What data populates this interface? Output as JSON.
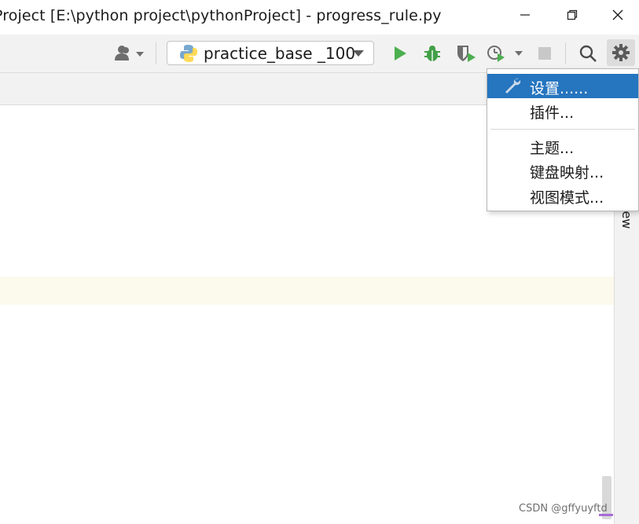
{
  "window": {
    "title": "Project [E:\\python project\\pythonProject] - progress_rule.py"
  },
  "toolbar": {
    "run_config_label": "practice_base _100",
    "icons": [
      "user-icon",
      "python-icon",
      "run-icon",
      "debug-icon",
      "coverage-icon",
      "profile-icon",
      "stop-icon",
      "search-icon",
      "gear-icon"
    ]
  },
  "settings_menu": {
    "items": [
      {
        "label": "设置......",
        "selected": true
      },
      {
        "label": "插件..."
      },
      {
        "label": "主题..."
      },
      {
        "label": "键盘映射..."
      },
      {
        "label": "视图模式..."
      }
    ]
  },
  "side_panel": {
    "label": "iew"
  },
  "watermark": "CSDN @gffyuyftd",
  "colors": {
    "accent": "#2675bf",
    "run_green": "#4caf50",
    "caret_line": "#fcfaed"
  }
}
